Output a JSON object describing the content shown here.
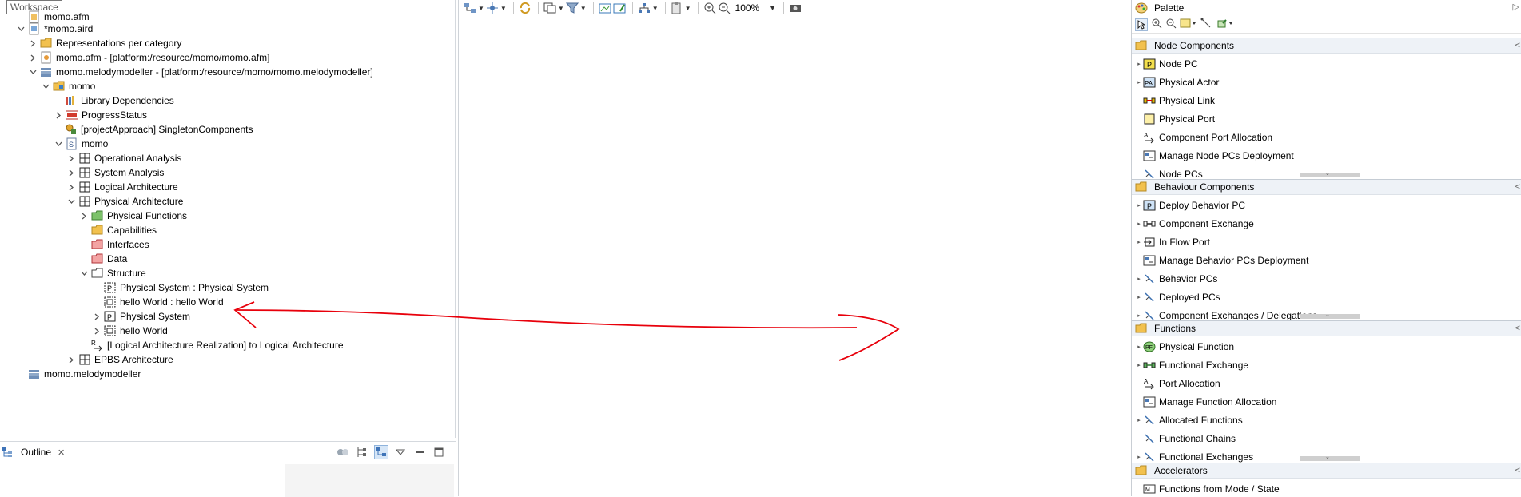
{
  "tooltip": "Workspace",
  "explorer": {
    "rows": [
      {
        "label": "momo.afm"
      },
      {
        "label": "*momo.aird"
      },
      {
        "label": "Representations per category"
      },
      {
        "label": "momo.afm - [platform:/resource/momo/momo.afm]"
      },
      {
        "label": "momo.melodymodeller - [platform:/resource/momo/momo.melodymodeller]"
      },
      {
        "label": "momo"
      },
      {
        "label": "Library Dependencies"
      },
      {
        "label": "ProgressStatus"
      },
      {
        "label": "[projectApproach] SingletonComponents"
      },
      {
        "label": "momo"
      },
      {
        "label": "Operational Analysis"
      },
      {
        "label": "System Analysis"
      },
      {
        "label": "Logical Architecture"
      },
      {
        "label": "Physical Architecture"
      },
      {
        "label": "Physical Functions"
      },
      {
        "label": "Capabilities"
      },
      {
        "label": "Interfaces"
      },
      {
        "label": "Data"
      },
      {
        "label": "Structure"
      },
      {
        "label": "Physical System : Physical System"
      },
      {
        "label": "hello World : hello World"
      },
      {
        "label": "Physical System"
      },
      {
        "label": "hello World"
      },
      {
        "label": "[Logical Architecture Realization] to Logical Architecture"
      },
      {
        "label": "EPBS Architecture"
      },
      {
        "label": "momo.melodymodeller"
      }
    ]
  },
  "outline": {
    "tab_label": "Outline"
  },
  "editor": {
    "zoom": "100%"
  },
  "palette": {
    "title": "Palette",
    "drawers": [
      {
        "title": "Node Components",
        "items": [
          "Node PC",
          "Physical Actor",
          "Physical Link",
          "Physical Port",
          "Component Port Allocation",
          "Manage Node PCs Deployment",
          "Node PCs"
        ]
      },
      {
        "title": "Behaviour Components",
        "items": [
          "Deploy Behavior PC",
          "Component Exchange",
          "In Flow Port",
          "Manage Behavior PCs Deployment",
          "Behavior PCs",
          "Deployed PCs",
          "Component Exchanges / Delegations"
        ]
      },
      {
        "title": "Functions",
        "items": [
          "Physical Function",
          "Functional Exchange",
          "Port Allocation",
          "Manage Function Allocation",
          "Allocated Functions",
          "Functional Chains",
          "Functional Exchanges"
        ]
      },
      {
        "title": "Accelerators",
        "items": [
          "Functions from Mode / State"
        ]
      }
    ]
  },
  "colors": {
    "annotation": "#e8000b",
    "drawer_bg": "#eef2f7",
    "folder": "#e8b84a"
  }
}
